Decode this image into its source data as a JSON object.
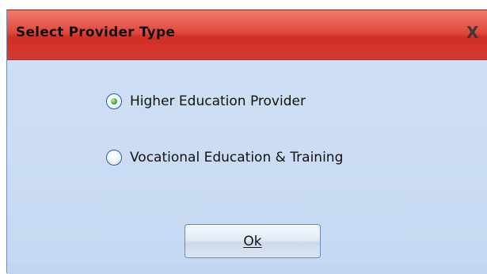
{
  "dialog": {
    "title": "Select Provider Type",
    "close_glyph": "X"
  },
  "options": [
    {
      "label": "Higher Education Provider",
      "selected": true
    },
    {
      "label": "Vocational Education & Training",
      "selected": false
    }
  ],
  "buttons": {
    "ok_label": "Ok"
  },
  "colors": {
    "titlebar_accent": "#d33a2f",
    "body_background": "#c9daf4",
    "radio_selected": "#35b12e"
  }
}
